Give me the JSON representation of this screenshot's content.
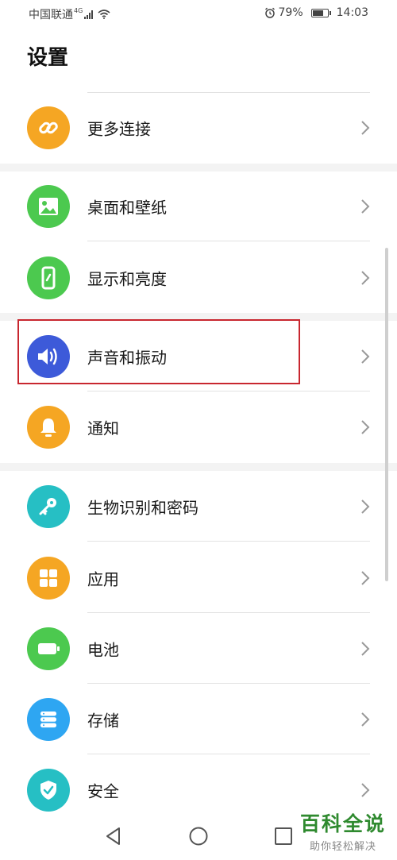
{
  "status_bar": {
    "carrier": "中国联通",
    "network": "4G",
    "battery": "79%",
    "battery_level": 0.79,
    "time": "14:03",
    "icons": [
      "signal-icon",
      "wifi-icon",
      "alarm-icon",
      "battery-icon"
    ]
  },
  "title": "设置",
  "items": [
    {
      "label": "更多连接",
      "icon": "link-icon",
      "color": "#F5A623"
    },
    {
      "label": "桌面和壁纸",
      "icon": "image-icon",
      "color": "#4CC94F"
    },
    {
      "label": "显示和亮度",
      "icon": "phone-brightness-icon",
      "color": "#4CC94F"
    },
    {
      "label": "声音和振动",
      "icon": "speaker-icon",
      "color": "#3D5AD9"
    },
    {
      "label": "通知",
      "icon": "bell-icon",
      "color": "#F5A623"
    },
    {
      "label": "生物识别和密码",
      "icon": "key-icon",
      "color": "#26BFC4"
    },
    {
      "label": "应用",
      "icon": "apps-grid-icon",
      "color": "#F5A623"
    },
    {
      "label": "电池",
      "icon": "battery-icon",
      "color": "#4CC94F"
    },
    {
      "label": "存储",
      "icon": "storage-icon",
      "color": "#2EA6F2"
    },
    {
      "label": "安全",
      "icon": "shield-icon",
      "color": "#26BFC4"
    }
  ],
  "highlight_color": "#C8272F",
  "nav": {
    "icons": [
      "back-icon",
      "home-icon",
      "recents-icon"
    ]
  },
  "watermark": {
    "main": "百科全说",
    "sub": "助你轻松解决"
  }
}
